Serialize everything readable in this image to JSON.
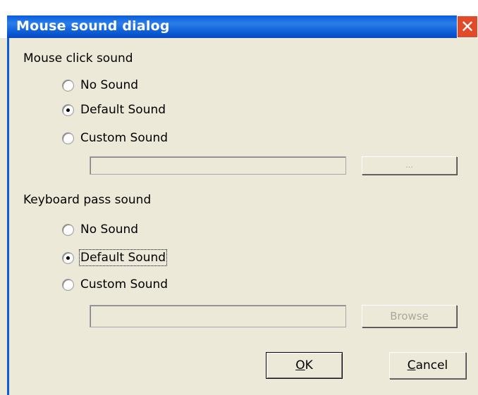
{
  "window": {
    "title": "Mouse sound dialog",
    "close_glyph": "✕"
  },
  "mouse": {
    "heading": "Mouse click sound",
    "options": [
      "No Sound",
      "Default Sound",
      "Custom Sound"
    ],
    "selected": "Default Sound",
    "path_value": "",
    "browse_label": "..."
  },
  "keyboard": {
    "heading": "Keyboard pass sound",
    "options": [
      "No Sound",
      "Default Sound",
      "Custom Sound"
    ],
    "selected": "Default Sound",
    "path_value": "",
    "browse_label": "Browse"
  },
  "buttons": {
    "ok_mnemonic": "O",
    "ok_rest": "K",
    "cancel_mnemonic": "C",
    "cancel_rest": "ancel"
  }
}
